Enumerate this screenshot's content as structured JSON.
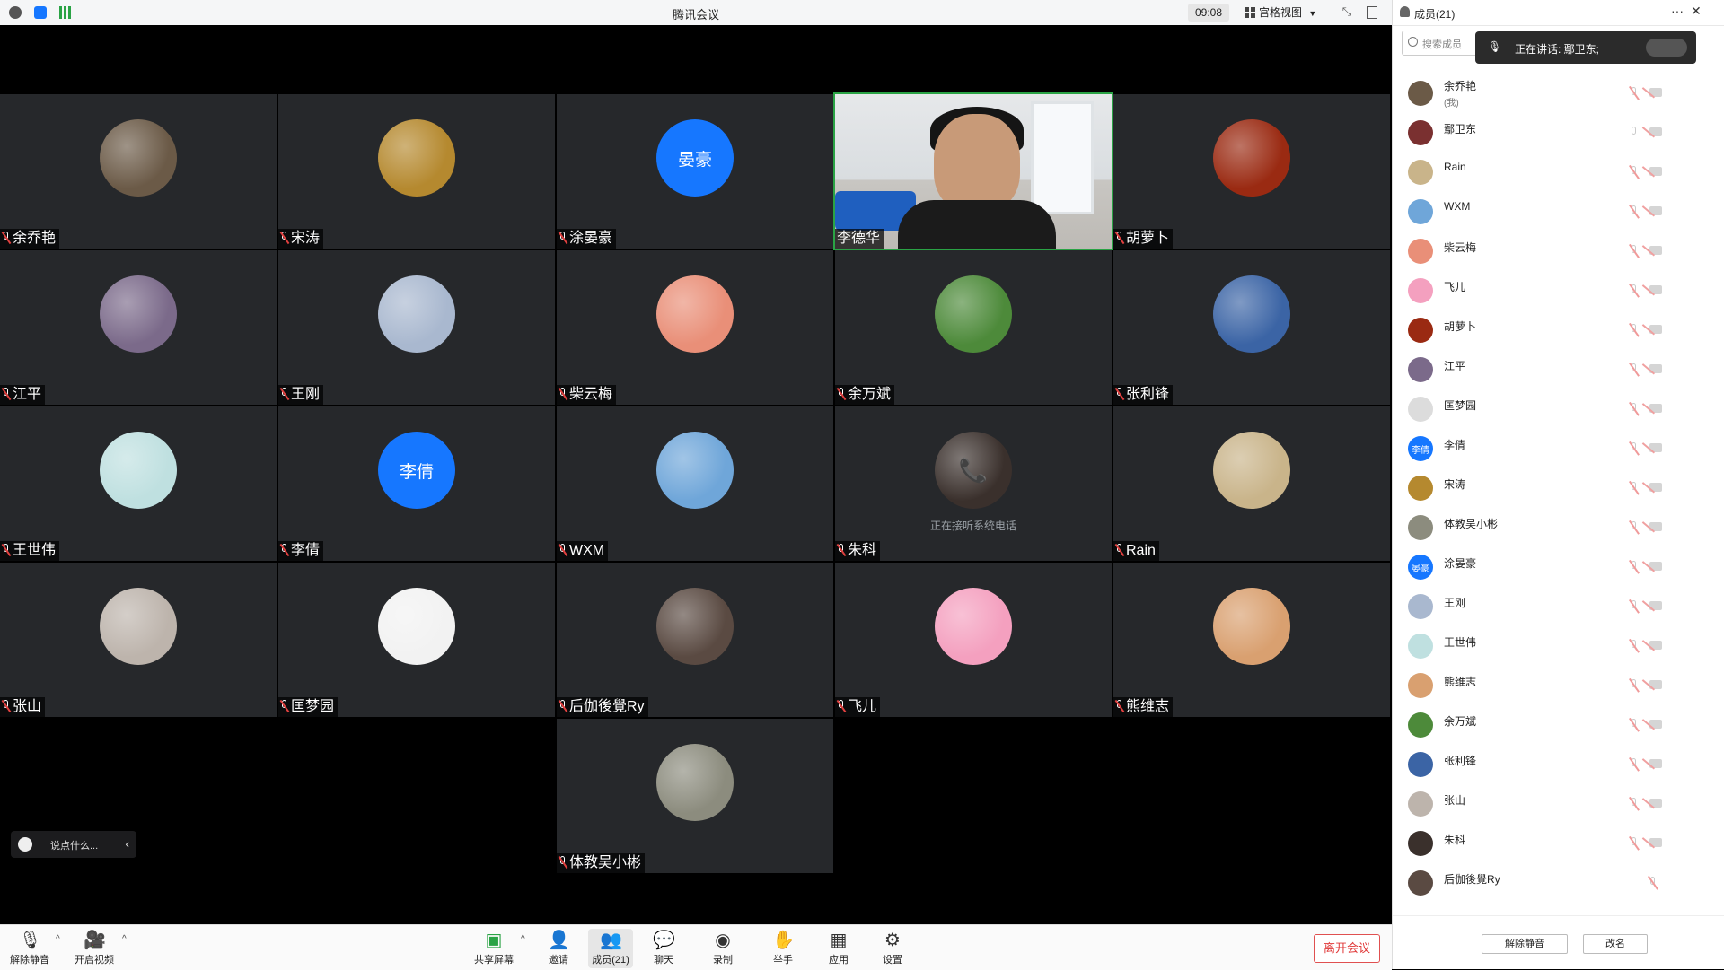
{
  "titlebar": {
    "app_title": "腾讯会议",
    "clock": "09:08",
    "view_label": "宫格视图"
  },
  "gallery": {
    "tiles": [
      {
        "name": "余乔艳",
        "avatar_color": "#6b5a47",
        "avatar_text": ""
      },
      {
        "name": "宋涛",
        "avatar_color": "#b5892f",
        "avatar_text": ""
      },
      {
        "name": "涂晏豪",
        "avatar_color": "#1677ff",
        "avatar_text": "晏豪"
      },
      {
        "name": "李德华",
        "video": true
      },
      {
        "name": "胡萝卜",
        "avatar_color": "#9a2a12",
        "avatar_text": ""
      },
      {
        "name": "江平",
        "avatar_color": "#7b6a8a",
        "avatar_text": ""
      },
      {
        "name": "王刚",
        "avatar_color": "#a9b8cf",
        "avatar_text": ""
      },
      {
        "name": "柴云梅",
        "avatar_color": "#e98f78",
        "avatar_text": ""
      },
      {
        "name": "余万斌",
        "avatar_color": "#4d8a3a",
        "avatar_text": ""
      },
      {
        "name": "张利锋",
        "avatar_color": "#3b64a5",
        "avatar_text": ""
      },
      {
        "name": "王世伟",
        "avatar_color": "#bfe0e0",
        "avatar_text": ""
      },
      {
        "name": "李倩",
        "avatar_color": "#1677ff",
        "avatar_text": "李倩"
      },
      {
        "name": "WXM",
        "avatar_color": "#6fa6d9",
        "avatar_text": ""
      },
      {
        "name": "朱科",
        "avatar_color": "#3a302c",
        "avatar_text": "",
        "phone": true,
        "status_text": "正在接听系统电话"
      },
      {
        "name": "Rain",
        "avatar_color": "#c9b48a",
        "avatar_text": ""
      },
      {
        "name": "张山",
        "avatar_color": "#bdb4ac",
        "avatar_text": ""
      },
      {
        "name": "匡梦园",
        "avatar_color": "#f2f2f2",
        "avatar_text": ""
      },
      {
        "name": "后伽後覺Ry",
        "avatar_color": "#5a4a42",
        "avatar_text": ""
      },
      {
        "name": "飞儿",
        "avatar_color": "#f4a0bf",
        "avatar_text": ""
      },
      {
        "name": "熊维志",
        "avatar_color": "#d9a070",
        "avatar_text": ""
      },
      {
        "name": "体教吴小彬",
        "avatar_color": "#8c8c7e",
        "avatar_text": ""
      }
    ]
  },
  "chat": {
    "placeholder": "说点什么..."
  },
  "toolbar": {
    "unmute": "解除静音",
    "start_video": "开启视频",
    "share_screen": "共享屏幕",
    "invite": "邀请",
    "members": "成员(21)",
    "chat": "聊天",
    "record": "录制",
    "raise_hand": "举手",
    "apps": "应用",
    "settings": "设置",
    "leave": "离开会议"
  },
  "panel": {
    "title": "成员(21)",
    "search_placeholder": "搜索成员",
    "speaking": "正在讲话: 鄢卫东;",
    "members": [
      {
        "name": "余乔艳",
        "sub": "(我)",
        "color": "#6b5a47",
        "text": ""
      },
      {
        "name": "鄢卫东",
        "sub": "",
        "color": "#7a3030",
        "text": "",
        "unmuted": true
      },
      {
        "name": "Rain",
        "sub": "",
        "color": "#c9b48a",
        "text": ""
      },
      {
        "name": "WXM",
        "sub": "",
        "color": "#6fa6d9",
        "text": ""
      },
      {
        "name": "柴云梅",
        "sub": "",
        "color": "#e98f78",
        "text": ""
      },
      {
        "name": "飞儿",
        "sub": "",
        "color": "#f4a0bf",
        "text": ""
      },
      {
        "name": "胡萝卜",
        "sub": "",
        "color": "#9a2a12",
        "text": ""
      },
      {
        "name": "江平",
        "sub": "",
        "color": "#7b6a8a",
        "text": ""
      },
      {
        "name": "匡梦园",
        "sub": "",
        "color": "#dcdcdc",
        "text": ""
      },
      {
        "name": "李倩",
        "sub": "",
        "color": "#1677ff",
        "text": "李倩"
      },
      {
        "name": "宋涛",
        "sub": "",
        "color": "#b5892f",
        "text": ""
      },
      {
        "name": "体教吴小彬",
        "sub": "",
        "color": "#8c8c7e",
        "text": ""
      },
      {
        "name": "涂晏豪",
        "sub": "",
        "color": "#1677ff",
        "text": "晏豪"
      },
      {
        "name": "王刚",
        "sub": "",
        "color": "#a9b8cf",
        "text": ""
      },
      {
        "name": "王世伟",
        "sub": "",
        "color": "#bfe0e0",
        "text": ""
      },
      {
        "name": "熊维志",
        "sub": "",
        "color": "#d9a070",
        "text": ""
      },
      {
        "name": "余万斌",
        "sub": "",
        "color": "#4d8a3a",
        "text": ""
      },
      {
        "name": "张利锋",
        "sub": "",
        "color": "#3b64a5",
        "text": ""
      },
      {
        "name": "张山",
        "sub": "",
        "color": "#bdb4ac",
        "text": ""
      },
      {
        "name": "朱科",
        "sub": "",
        "color": "#3a302c",
        "text": ""
      },
      {
        "name": "后伽後覺Ry",
        "sub": "",
        "color": "#5a4a42",
        "text": "",
        "no_cam": true
      }
    ],
    "unmute_all": "解除静音",
    "rename": "改名"
  }
}
